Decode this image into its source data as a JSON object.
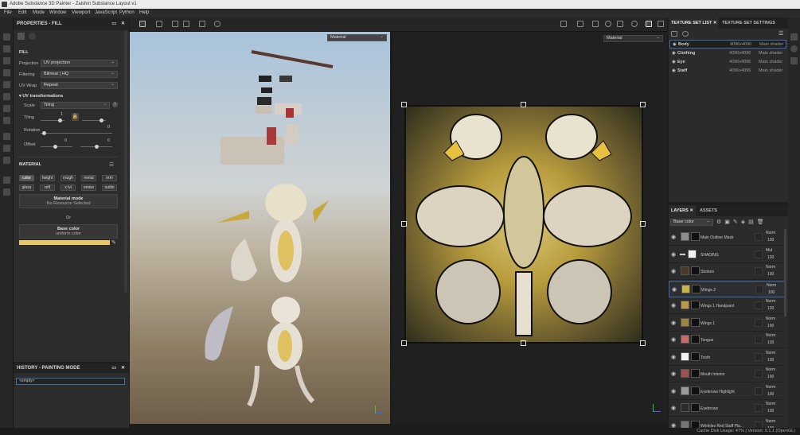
{
  "app": {
    "title": "Adobe Substance 3D Painter - Zaishin Substance Layout v1"
  },
  "menu": [
    "File",
    "Edit",
    "Mode",
    "Window",
    "Viewport",
    "JavaScript",
    "Python",
    "Help"
  ],
  "properties": {
    "title": "PROPERTIES - FILL",
    "section": "FILL",
    "projection_label": "Projection",
    "projection_value": "UV projection",
    "filtering_label": "Filtering",
    "filtering_value": "Bilinear | HQ",
    "uvwrap_label": "UV Wrap",
    "uvwrap_value": "Repeat",
    "uvtrans_label": "UV transformations",
    "scale_label": "Scale",
    "scale_value": "Tiling",
    "tiling_label": "Tiling",
    "tiling_num": "1",
    "rotation_label": "Rotation",
    "rotation_num": "0",
    "offset_label": "Offset",
    "offset_x": "0",
    "offset_y": "0",
    "material_section": "MATERIAL",
    "channels": [
      "color",
      "height",
      "rough",
      "metal",
      "nrm",
      "gloss",
      "refl",
      "x lvl",
      "emiss",
      "outlin"
    ],
    "material_mode_title": "Material mode",
    "material_mode_sub": "No Resource Selected",
    "or": "Or",
    "base_color_title": "Base color",
    "base_color_sub": "uniform color",
    "base_color_hex": "#e8c66a"
  },
  "history": {
    "title": "HISTORY - PAINTING MODE",
    "item": "<empty>"
  },
  "viewport": {
    "left_dropdown": "Material",
    "right_dropdown": "Material"
  },
  "texture_sets": {
    "tab1": "TEXTURE SET LIST",
    "tab2": "TEXTURE SET SETTINGS",
    "rows": [
      {
        "name": "Body",
        "res": "4096x4096",
        "shader": "Main shader"
      },
      {
        "name": "Clothing",
        "res": "4096x4096",
        "shader": "Main shader"
      },
      {
        "name": "Eye",
        "res": "4096x4096",
        "shader": "Main shader"
      },
      {
        "name": "Staff",
        "res": "4096x4096",
        "shader": "Main shader"
      }
    ]
  },
  "layers": {
    "tab1": "LAYERS",
    "tab2": "ASSETS",
    "channel": "Base color",
    "rows": [
      {
        "name": "Main Outline Mask",
        "blend": "Norm",
        "opacity": "100",
        "thumb": "#8e8e8e"
      },
      {
        "name": "SHADING",
        "blend": "Mul",
        "opacity": "100",
        "thumb": "#f0f0f0"
      },
      {
        "name": "Strokes",
        "blend": "Norm",
        "opacity": "100",
        "thumb": "#4a3a2a"
      },
      {
        "name": "Wings 2",
        "blend": "Norm",
        "opacity": "100",
        "thumb": "#c8b24a"
      },
      {
        "name": "Wings 1 Handpaint",
        "blend": "Norm",
        "opacity": "100",
        "thumb": "#b89a4a"
      },
      {
        "name": "Wings 1",
        "blend": "Norm",
        "opacity": "100",
        "thumb": "#9a8440"
      },
      {
        "name": "Tongue",
        "blend": "Norm",
        "opacity": "100",
        "thumb": "#c86a6a"
      },
      {
        "name": "Tooth",
        "blend": "Norm",
        "opacity": "100",
        "thumb": "#f2f2f2"
      },
      {
        "name": "Mouth Interior",
        "blend": "Norm",
        "opacity": "100",
        "thumb": "#a05050"
      },
      {
        "name": "Eyebrows Highlight",
        "blend": "Norm",
        "opacity": "100",
        "thumb": "#9a9a9a"
      },
      {
        "name": "Eyebrows",
        "blend": "Norm",
        "opacity": "100",
        "thumb": "#2a2a2a"
      },
      {
        "name": "Wrinkles Red Stuff Pla...",
        "blend": "Norm",
        "opacity": "100",
        "thumb": "#777777"
      }
    ]
  },
  "status": {
    "text": "Cache Disk Usage:  47%  |  Version: 9.1.1 (OpenGL)"
  }
}
